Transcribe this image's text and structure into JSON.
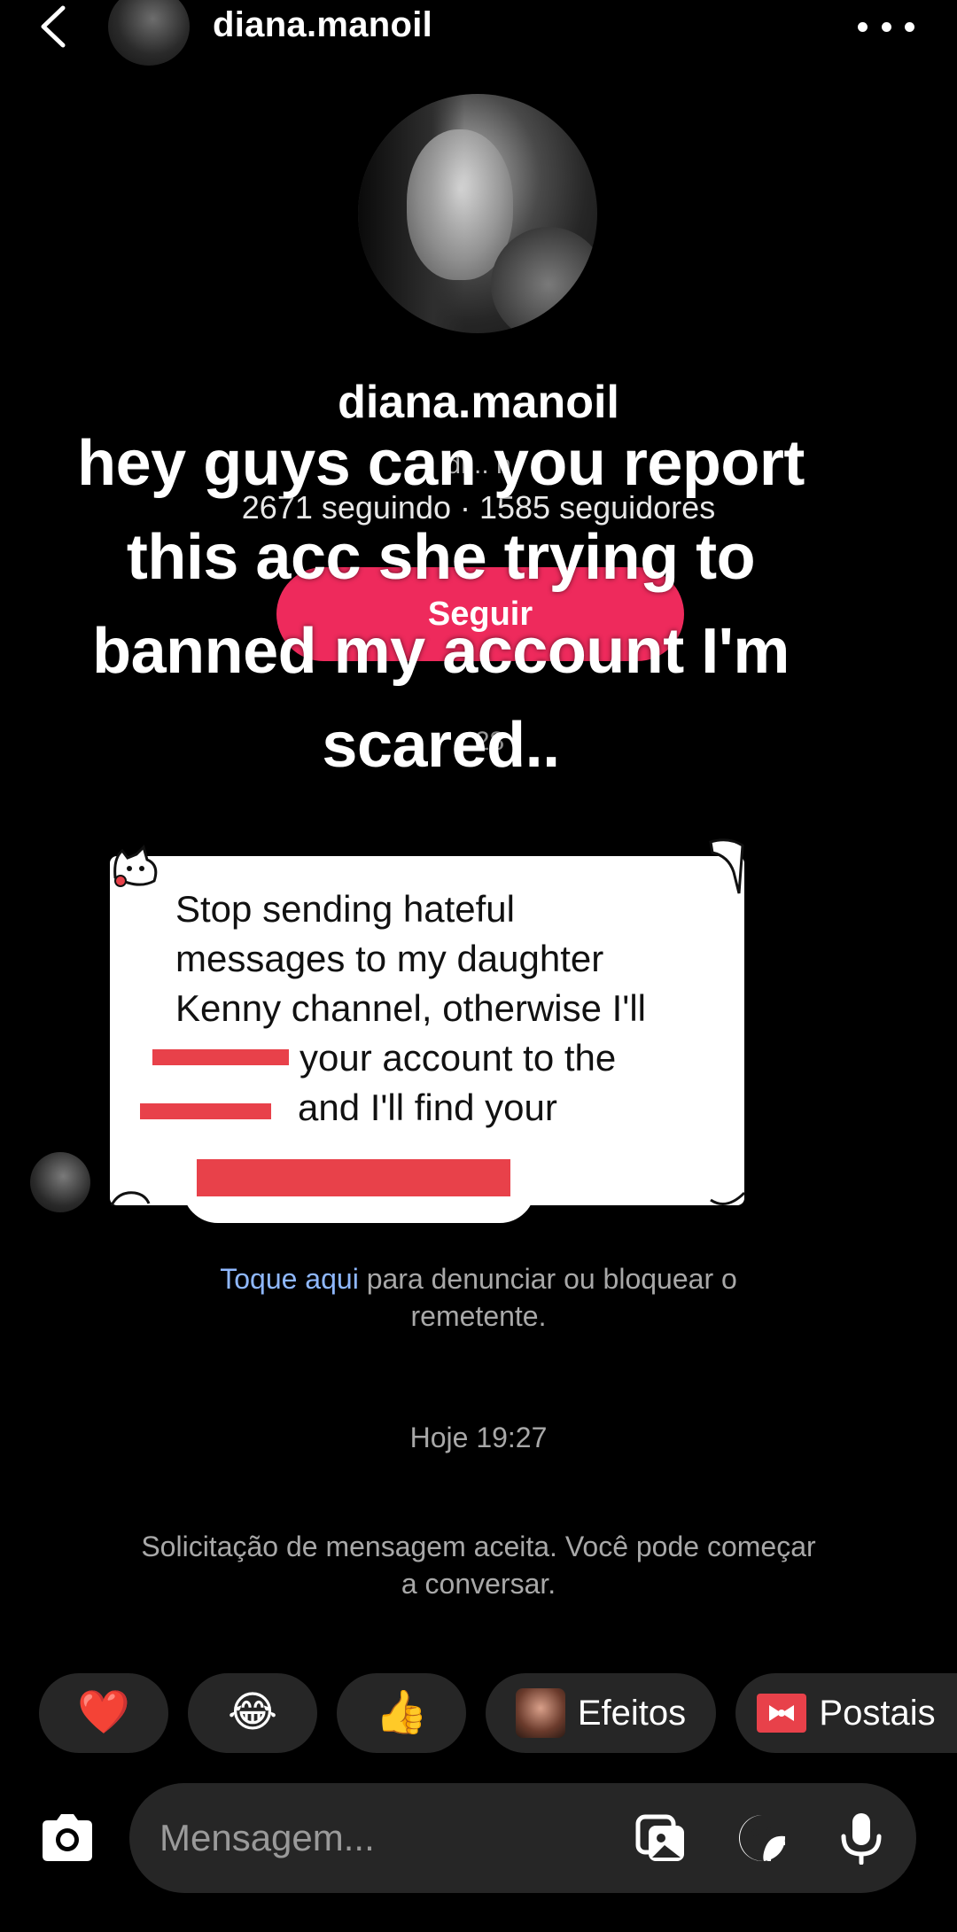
{
  "header": {
    "username": "diana.manoil",
    "back_icon": "chevron-left-icon",
    "more_icon": "more-horizontal-icon"
  },
  "profile": {
    "username": "diana.manoil",
    "subtitle": "di... n",
    "stats": "2671 seguindo · 1585 seguidores",
    "follow_label": "Seguir",
    "extra": "...28",
    "follow_color": "#ee2a5c"
  },
  "caption": {
    "text": "hey guys can you report this acc she trying to banned my account I'm scared.."
  },
  "message": {
    "line1": "Stop sending hateful",
    "line2": "messages to my daughter",
    "line3": "Kenny channel, otherwise I'll",
    "line4": "your account to the",
    "line5": "and I'll find your",
    "redaction_color": "#e8414a"
  },
  "notices": {
    "report_link": "Toque aqui",
    "report_text": " para denunciar ou bloquear o remetente.",
    "timestamp": "Hoje 19:27",
    "accepted": "Solicitação de mensagem aceita. Você pode começar a conversar.",
    "link_color": "#8fb8ff"
  },
  "reactions": [
    {
      "emoji": "❤️",
      "name": "heart"
    },
    {
      "emoji": "😂",
      "name": "laugh"
    },
    {
      "emoji": "👍",
      "name": "thumbs-up"
    }
  ],
  "chips": {
    "effects_label": "Efeitos",
    "postcards_label": "Postais"
  },
  "composer": {
    "placeholder": "Mensagem...",
    "icons": [
      "camera-icon",
      "gallery-icon",
      "sticker-icon",
      "microphone-icon"
    ]
  }
}
